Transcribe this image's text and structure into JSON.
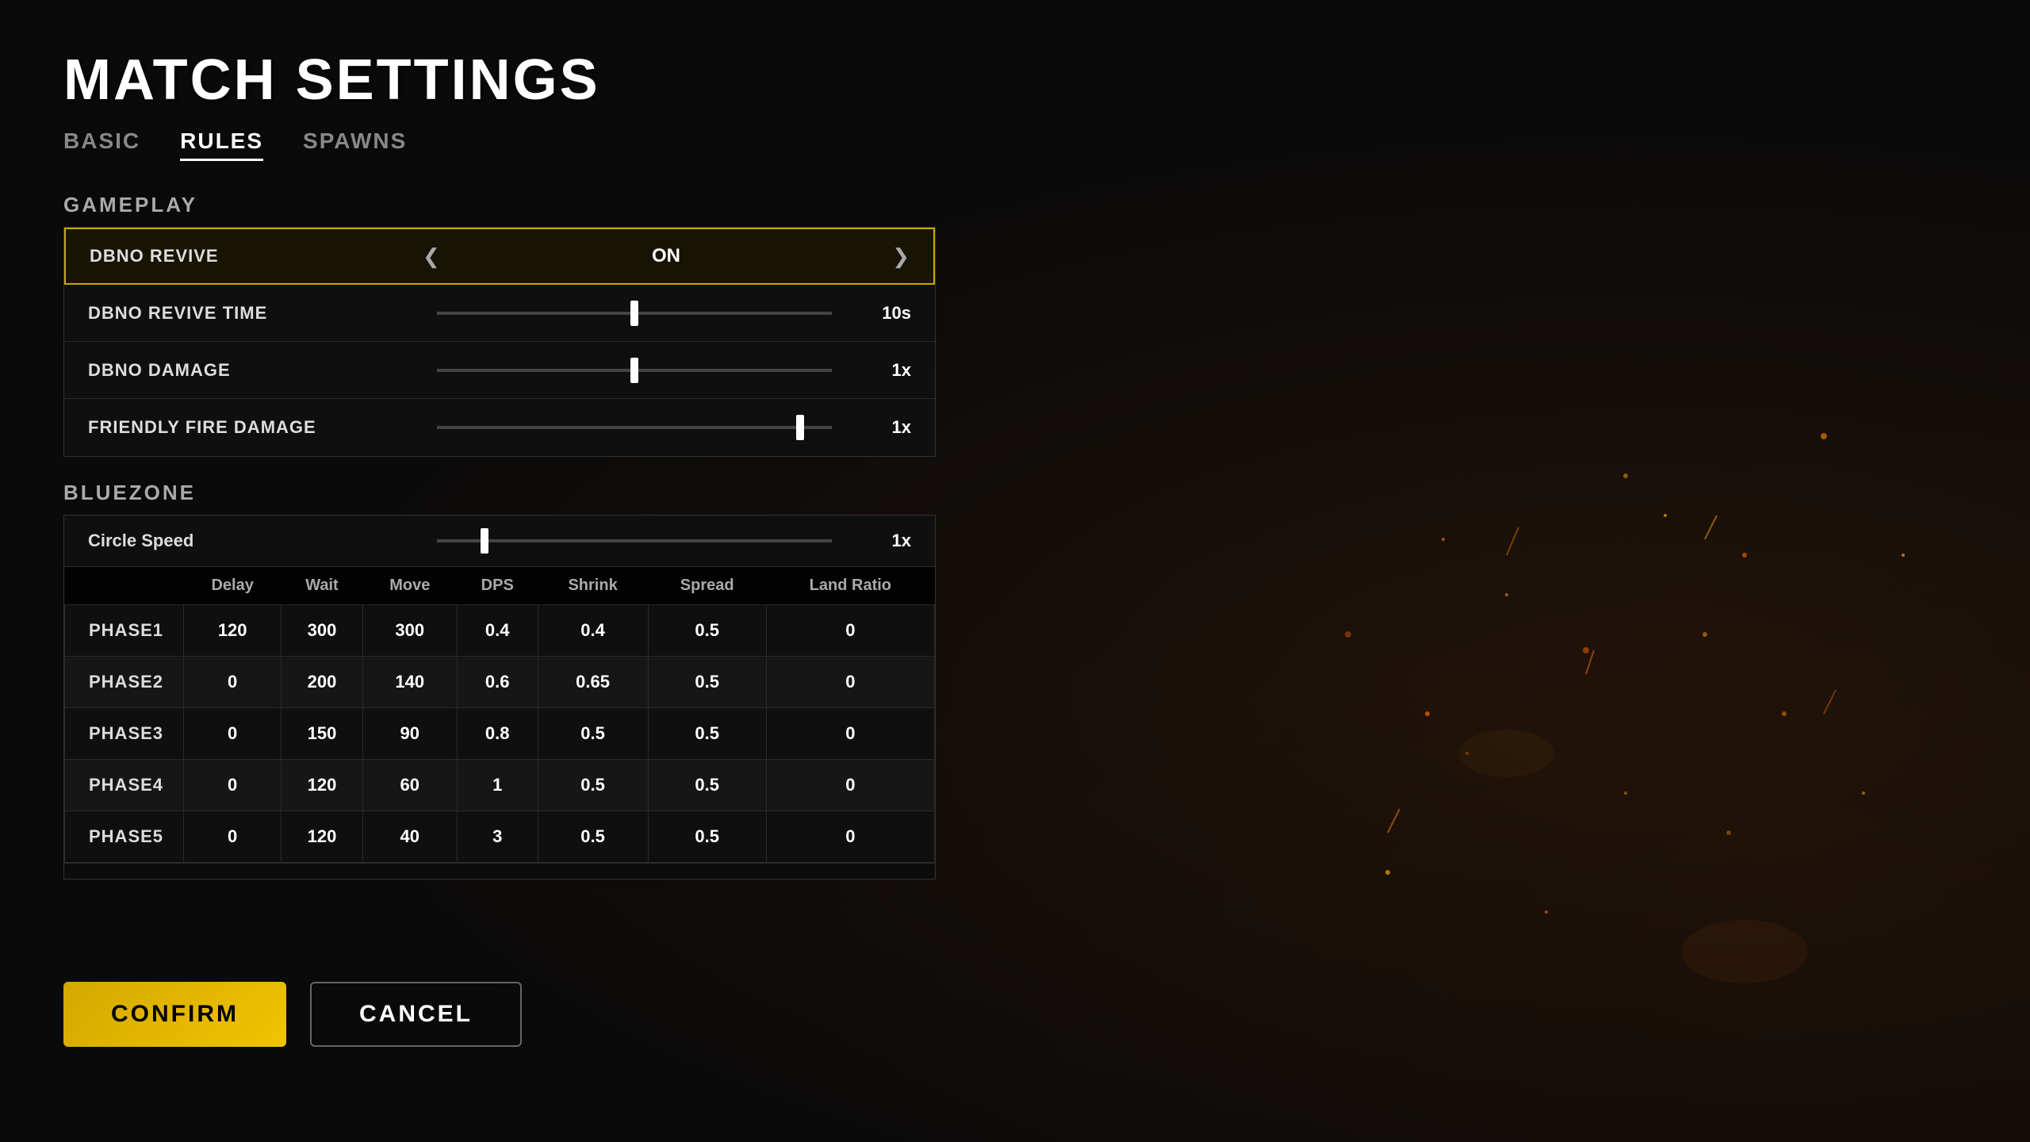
{
  "page": {
    "title": "MATCH SETTINGS"
  },
  "tabs": [
    {
      "id": "basic",
      "label": "BASIC",
      "active": false
    },
    {
      "id": "rules",
      "label": "RULES",
      "active": true
    },
    {
      "id": "spawns",
      "label": "SPAWNS",
      "active": false
    }
  ],
  "gameplay": {
    "section_label": "GAMEPLAY",
    "settings": [
      {
        "id": "dbno-revive",
        "name": "DBNO REVIVE",
        "type": "toggle",
        "value": "ON",
        "highlighted": true
      },
      {
        "id": "dbno-revive-time",
        "name": "DBNO REVIVE TIME",
        "type": "slider",
        "value": "10s",
        "slider_pos": 0.5
      },
      {
        "id": "dbno-damage",
        "name": "DBNO DAMAGE",
        "type": "slider",
        "value": "1x",
        "slider_pos": 0.5
      },
      {
        "id": "friendly-fire-damage",
        "name": "FRIENDLY FIRE DAMAGE",
        "type": "slider",
        "value": "1x",
        "slider_pos": 0.92
      }
    ]
  },
  "bluezone": {
    "section_label": "BLUEZONE",
    "circle_speed": {
      "label": "Circle Speed",
      "value": "1x",
      "slider_pos": 0.12
    },
    "table_headers": [
      "",
      "Delay",
      "Wait",
      "Move",
      "DPS",
      "Shrink",
      "Spread",
      "Land Ratio"
    ],
    "phases": [
      {
        "name": "PHASE1",
        "delay": 120,
        "wait": 300,
        "move": 300,
        "dps": 0.4,
        "shrink": 0.4,
        "spread": 0.5,
        "land_ratio": 0
      },
      {
        "name": "PHASE2",
        "delay": 0,
        "wait": 200,
        "move": 140,
        "dps": 0.6,
        "shrink": 0.65,
        "spread": 0.5,
        "land_ratio": 0
      },
      {
        "name": "PHASE3",
        "delay": 0,
        "wait": 150,
        "move": 90,
        "dps": 0.8,
        "shrink": 0.5,
        "spread": 0.5,
        "land_ratio": 0
      },
      {
        "name": "PHASE4",
        "delay": 0,
        "wait": 120,
        "move": 60,
        "dps": 1,
        "shrink": 0.5,
        "spread": 0.5,
        "land_ratio": 0
      },
      {
        "name": "PHASE5",
        "delay": 0,
        "wait": 120,
        "move": 40,
        "dps": 3,
        "shrink": 0.5,
        "spread": 0.5,
        "land_ratio": 0
      }
    ]
  },
  "buttons": {
    "confirm": "CONFIRM",
    "cancel": "CANCEL"
  }
}
